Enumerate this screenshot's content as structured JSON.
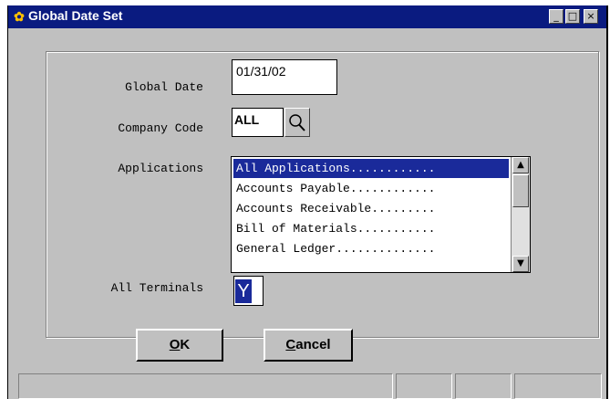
{
  "window": {
    "title": "Global Date Set",
    "minimize_glyph": "_",
    "maximize_glyph": "□",
    "close_glyph": "×"
  },
  "form": {
    "global_date": {
      "label": "Global Date",
      "value": "01/31/02"
    },
    "company_code": {
      "label": "Company Code",
      "value": "ALL",
      "lookup_icon": "magnifier-icon"
    },
    "applications": {
      "label": "Applications",
      "items": [
        "All Applications............",
        "Accounts Payable............",
        "Accounts Receivable.........",
        "Bill of Materials...........",
        "General Ledger.............."
      ],
      "selected_index": 0
    },
    "all_terminals": {
      "label": "All Terminals",
      "value": "Y"
    }
  },
  "buttons": {
    "ok": {
      "mnemonic": "O",
      "rest": "K"
    },
    "cancel": {
      "mnemonic": "C",
      "rest": "ancel"
    }
  },
  "colors": {
    "titlebar": "#0a1b80",
    "selection": "#1a2a9a",
    "face": "#c0c0c0"
  }
}
